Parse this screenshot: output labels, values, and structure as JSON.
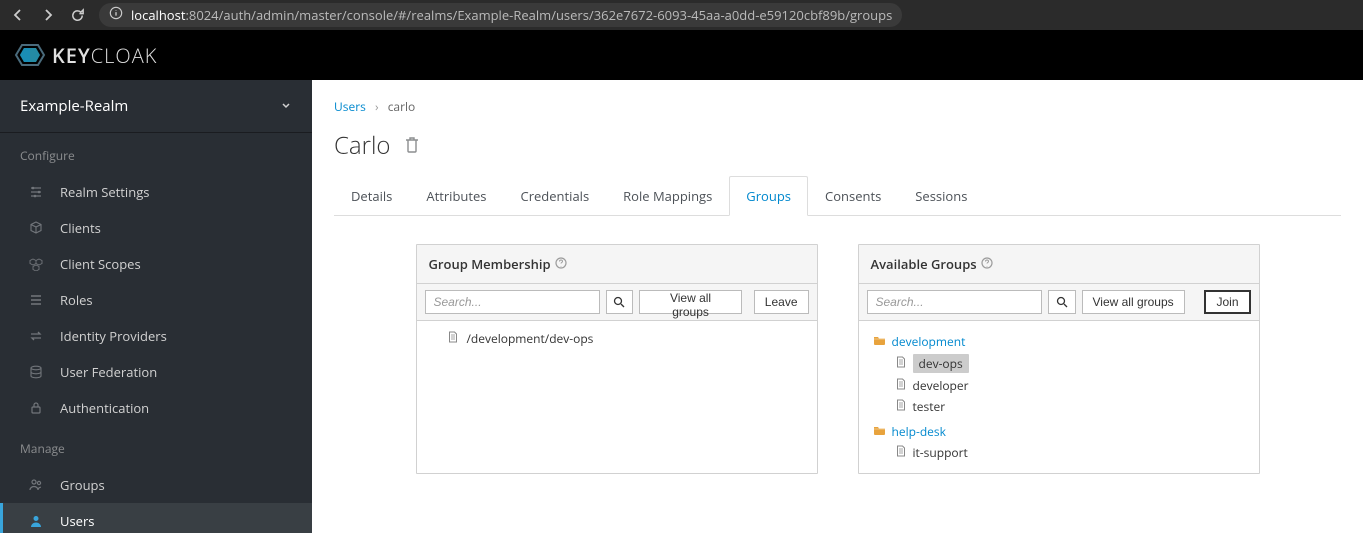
{
  "browser": {
    "url_host": "localhost",
    "url_path": ":8024/auth/admin/master/console/#/realms/Example-Realm/users/362e7672-6093-45aa-a0dd-e59120cbf89b/groups"
  },
  "header": {
    "logo_text1": "KEY",
    "logo_text2": "CLOAK"
  },
  "sidebar": {
    "realm_name": "Example-Realm",
    "section_configure": "Configure",
    "section_manage": "Manage",
    "configure_items": [
      {
        "label": "Realm Settings",
        "icon": "sliders"
      },
      {
        "label": "Clients",
        "icon": "cube"
      },
      {
        "label": "Client Scopes",
        "icon": "cubes"
      },
      {
        "label": "Roles",
        "icon": "list"
      },
      {
        "label": "Identity Providers",
        "icon": "exchange"
      },
      {
        "label": "User Federation",
        "icon": "database"
      },
      {
        "label": "Authentication",
        "icon": "lock"
      }
    ],
    "manage_items": [
      {
        "label": "Groups",
        "icon": "users",
        "active": false
      },
      {
        "label": "Users",
        "icon": "user",
        "active": true
      }
    ]
  },
  "breadcrumb": {
    "root": "Users",
    "current": "carlo"
  },
  "page": {
    "title": "Carlo"
  },
  "tabs": [
    {
      "label": "Details",
      "active": false
    },
    {
      "label": "Attributes",
      "active": false
    },
    {
      "label": "Credentials",
      "active": false
    },
    {
      "label": "Role Mappings",
      "active": false
    },
    {
      "label": "Groups",
      "active": true
    },
    {
      "label": "Consents",
      "active": false
    },
    {
      "label": "Sessions",
      "active": false
    }
  ],
  "membership": {
    "title": "Group Membership",
    "search_placeholder": "Search...",
    "view_all": "View all groups",
    "leave": "Leave",
    "items": [
      {
        "path": "/development/dev-ops"
      }
    ]
  },
  "available": {
    "title": "Available Groups",
    "search_placeholder": "Search...",
    "view_all": "View all groups",
    "join": "Join",
    "tree": [
      {
        "label": "development",
        "children": [
          {
            "label": "dev-ops",
            "selected": true
          },
          {
            "label": "developer"
          },
          {
            "label": "tester"
          }
        ]
      },
      {
        "label": "help-desk",
        "children": [
          {
            "label": "it-support"
          }
        ]
      }
    ]
  }
}
